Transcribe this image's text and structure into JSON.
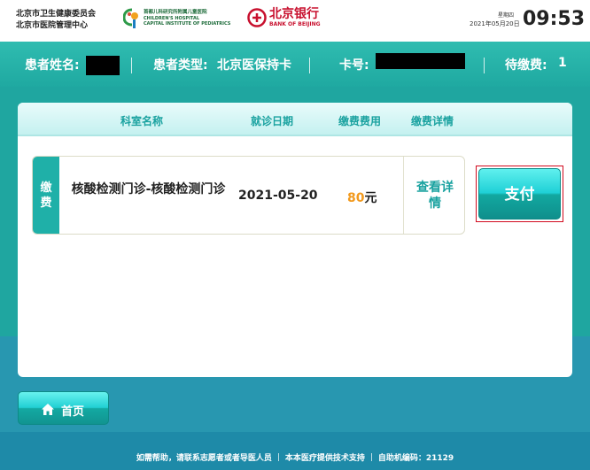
{
  "header": {
    "org_line1": "北京市卫生健康委员会",
    "org_line2": "北京市医院管理中心",
    "hospital_cn": "首都儿科研究所附属儿童医院",
    "hospital_en1": "CHILDREN'S HOSPITAL",
    "hospital_en2": "CAPITAL INSTITUTE OF PEDIATRICS",
    "bank_cn": "北京银行",
    "bank_en": "BANK OF BEIJING",
    "weekday": "星期四",
    "date": "2021年05月20日",
    "time": "09:53"
  },
  "patient": {
    "name_label": "患者姓名:",
    "type_label": "患者类型:",
    "type_value": "北京医保持卡",
    "card_label": "卡号:",
    "pending_label": "待缴费:",
    "pending_count": "1"
  },
  "table": {
    "columns": [
      "科室名称",
      "就诊日期",
      "缴费费用",
      "缴费详情"
    ],
    "row": {
      "tag": "缴费",
      "department": "核酸检测门诊-核酸检测门诊",
      "visit_date": "2021-05-20",
      "fee_amount": "80",
      "fee_unit": "元",
      "detail_link": "查看详情"
    }
  },
  "actions": {
    "pay_label": "支付",
    "home_label": "首页"
  },
  "footer": {
    "help": "如需帮助，请联系志愿者或者导医人员",
    "support": "本本医疗提供技术支持",
    "kiosk": "自助机编码：21129"
  },
  "colors": {
    "teal": "#1fa9a1",
    "accent_orange": "#f29a1e",
    "bank_red": "#c8102e"
  }
}
